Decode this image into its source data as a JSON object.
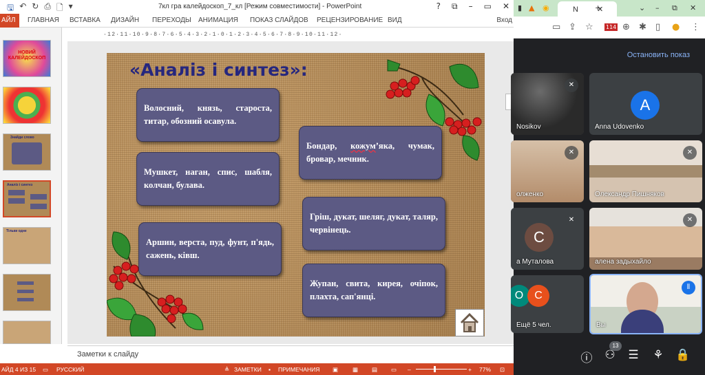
{
  "powerpoint": {
    "doc_title": "7кл гра калейдоскоп_7_кл [Режим совместимости] - PowerPoint",
    "title_buttons": [
      "?",
      "⧉",
      "–",
      "▭",
      "✕"
    ],
    "file_tab": "АЙЛ",
    "tabs": [
      "ГЛАВНАЯ",
      "ВСТАВКА",
      "ДИЗАЙН",
      "ПЕРЕХОДЫ",
      "АНИМАЦИЯ",
      "ПОКАЗ СЛАЙДОВ",
      "РЕЦЕНЗИРОВАНИЕ",
      "ВИД"
    ],
    "login": "Вход",
    "ruler": "·12·11·10·9·8·7·6·5·4·3·2·1·0·1·2·3·4·5·6·7·8·9·10·11·12·",
    "thumbnails": [
      {
        "title": "НОВИЙ КАЛЕЙДОСКОП"
      },
      {
        "title": ""
      },
      {
        "title": "Знайди слово"
      },
      {
        "title": "Аналіз і синтез"
      },
      {
        "title": "Тільки одне"
      },
      {
        "title": ""
      },
      {
        "title": ""
      }
    ],
    "notes_placeholder": "Заметки к слайду",
    "status": {
      "slide_info": "АЙД 4 ИЗ 15",
      "language": "РУССКИЙ",
      "notes": "ЗАМЕТКИ",
      "comments": "ПРИМЕЧАНИЯ",
      "zoom": "77%"
    }
  },
  "slide": {
    "title": "«Аналіз і синтез»:",
    "cards": [
      {
        "text": "Волосний, князь, староста, титар, обозний осавула."
      },
      {
        "text": "Мушкет, наган, спис, шабля, колчан, булава."
      },
      {
        "text": "Аршин, верста, пуд, фунт, п'ядь, сажень, ківш."
      },
      {
        "text_before": "Бондар, ",
        "text_underlined": "кожум",
        "text_after": "’яка, чумак, бровар, мечник."
      },
      {
        "text": "Гріш, дукат, шеляг, дукат, таляр, червінець."
      },
      {
        "text": "Жупан, свита, кирея, очіпок, плахта, сап'янці."
      }
    ],
    "colors": {
      "card": "#5c5a84",
      "title": "#26277e",
      "berry": "#d61f1f",
      "leaf": "#2e8b2e"
    }
  },
  "browser": {
    "active_tab_label": "N",
    "icons": [
      "back-icon",
      "share-icon",
      "star-icon",
      "calendar-icon",
      "globe-icon",
      "puzzle-icon",
      "sidebar-icon",
      "profile-icon",
      "menu-icon"
    ],
    "calendar_day": "114"
  },
  "meet": {
    "stop_presenting": "Остановить показ",
    "participants": [
      {
        "name": "Nosikov",
        "muted": true
      },
      {
        "name": "Anna Udovenko",
        "initial": "A",
        "color": "#1a73e8"
      },
      {
        "name": "олженко",
        "muted": true
      },
      {
        "name": "Олександр Пишняков",
        "muted": true
      },
      {
        "name": "а Муталова",
        "initial": "C",
        "color": "#6d4c41",
        "muted": true
      },
      {
        "name": "алена задыхайло",
        "muted": true
      },
      {
        "name": "Ещё 5 чел.",
        "initials": [
          "O",
          "C"
        ],
        "colors": [
          "#00897b",
          "#e8501c"
        ]
      },
      {
        "name": "Вы"
      }
    ],
    "participants_count": "13"
  }
}
